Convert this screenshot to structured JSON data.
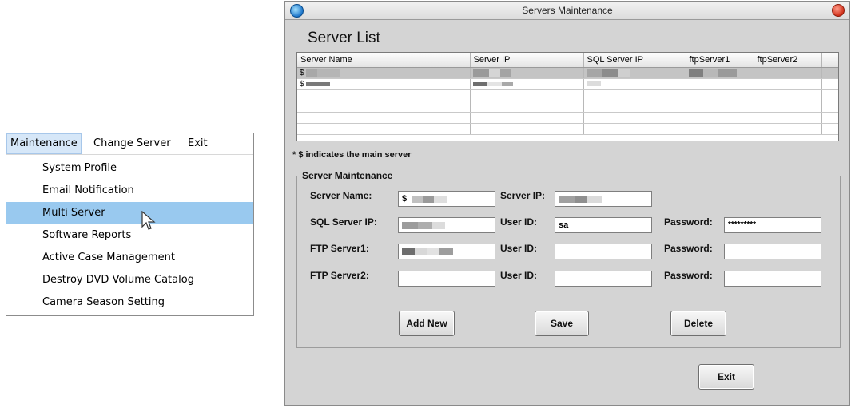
{
  "menu": {
    "bar": [
      "Maintenance",
      "Change Server",
      "Exit"
    ],
    "items": [
      "System Profile",
      "Email Notification",
      "Multi Server",
      "Software Reports",
      "Active Case Management",
      "Destroy DVD Volume Catalog",
      "Camera Season Setting"
    ],
    "highlighted": "Multi Server"
  },
  "window": {
    "title": "Servers Maintenance",
    "heading": "Server List",
    "columns": [
      "Server Name",
      "Server IP",
      "SQL Server IP",
      "ftpServer1",
      "ftpServer2"
    ],
    "rows": [
      {
        "server_name": "$"
      },
      {
        "server_name": "$"
      }
    ],
    "note": "* $ indicates the main server",
    "group_title": "Server Maintenance",
    "labels": {
      "server_name": "Server Name:",
      "server_ip": "Server IP:",
      "sql_server_ip": "SQL Server IP:",
      "user_id": "User ID:",
      "password": "Password:",
      "ftp_server1": "FTP Server1:",
      "ftp_server2": "FTP Server2:"
    },
    "values": {
      "server_name": "$",
      "sql_user_id": "sa",
      "sql_password": "*********"
    },
    "buttons": {
      "add_new": "Add New",
      "save": "Save",
      "delete": "Delete",
      "exit": "Exit"
    }
  }
}
